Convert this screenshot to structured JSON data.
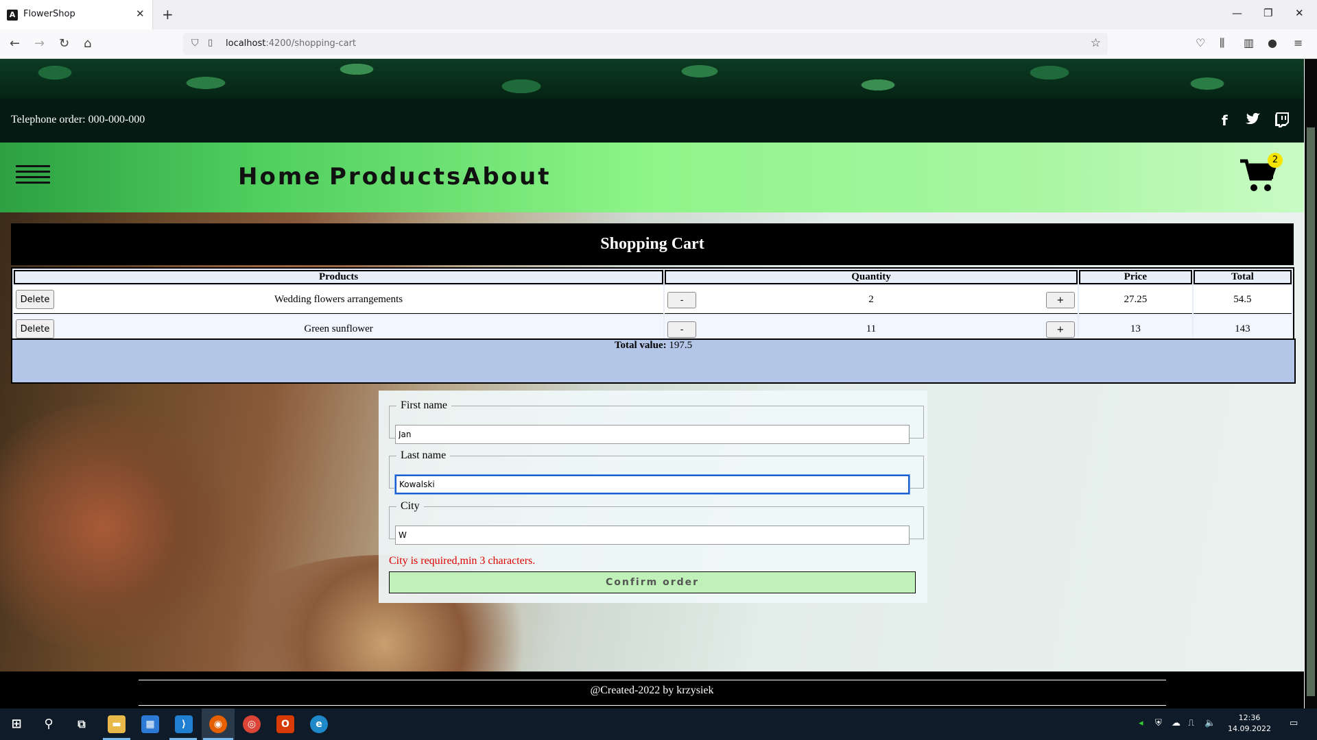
{
  "browser": {
    "tab_title": "FlowerShop",
    "url_host": "localhost",
    "url_path": ":4200/shopping-cart"
  },
  "site": {
    "telephone": "Telephone order: 000-000-000",
    "menu": [
      "Home",
      "Products",
      "About"
    ],
    "cart_count": "2"
  },
  "cart": {
    "title": "Shopping Cart",
    "columns": [
      "Products",
      "Quantity",
      "Price",
      "Total"
    ],
    "delete_label": "Delete",
    "minus_label": "-",
    "plus_label": "+",
    "rows": [
      {
        "product": "Wedding flowers arrangements",
        "quantity": "2",
        "price": "27.25",
        "total": "54.5"
      },
      {
        "product": "Green sunflower",
        "quantity": "11",
        "price": "13",
        "total": "143"
      }
    ],
    "total_label": "Total value:",
    "total_value": " 197.5"
  },
  "form": {
    "first_name_label": "First name",
    "first_name_value": "Jan",
    "last_name_label": "Last name",
    "last_name_value": "Kowalski",
    "city_label": "City",
    "city_value": "W",
    "error": "City is required,min 3 characters.",
    "confirm_label": "Confirm order"
  },
  "footer": {
    "text": "@Created-2022 by krzysiek"
  },
  "taskbar": {
    "time": "12:36",
    "date": "14.09.2022"
  }
}
